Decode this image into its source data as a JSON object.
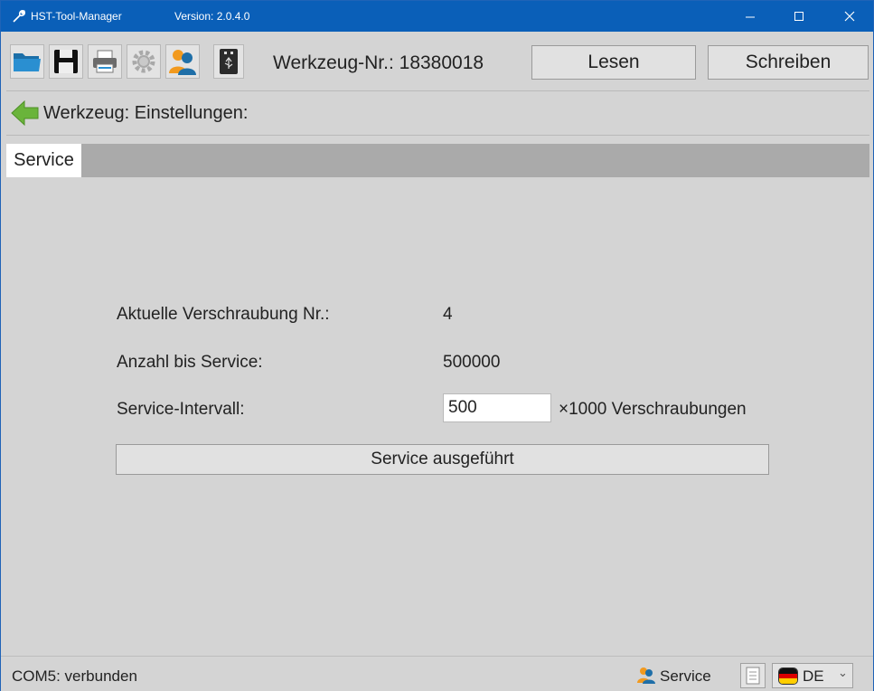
{
  "titlebar": {
    "title": "HST-Tool-Manager",
    "version": "Version: 2.0.4.0",
    "color": "#0a5fb8"
  },
  "toolbar": {
    "icons": [
      "folder-icon",
      "save-icon",
      "print-icon",
      "settings-icon",
      "user-icon",
      "usb-icon"
    ],
    "tool_number": "Werkzeug-Nr.: 18380018",
    "read_label": "Lesen",
    "write_label": "Schreiben"
  },
  "breadcrumb": {
    "text": "Werkzeug: Einstellungen:"
  },
  "tabs": [
    {
      "label": "Service",
      "active": true
    }
  ],
  "service": {
    "current_label": "Aktuelle Verschraubung Nr.:",
    "current_value": "4",
    "remaining_label": "Anzahl bis Service:",
    "remaining_value": "500000",
    "interval_label": "Service-Intervall:",
    "interval_value": "500",
    "interval_unit": "×1000 Verschraubungen",
    "button_label": "Service ausgeführt"
  },
  "statusbar": {
    "connection": "COM5: verbunden",
    "user_role": "Service",
    "language": "DE"
  }
}
